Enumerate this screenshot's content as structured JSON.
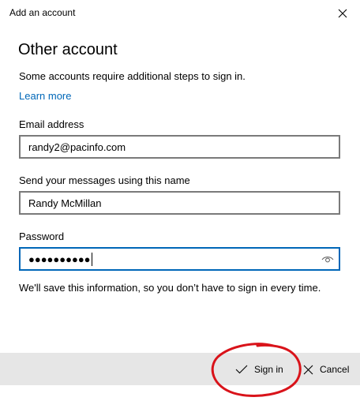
{
  "window": {
    "title": "Add an account"
  },
  "icons": {
    "close": "close-icon",
    "reveal": "eye-icon",
    "sign_in": "checkmark-icon",
    "cancel": "x-icon"
  },
  "main": {
    "heading": "Other account",
    "info": "Some accounts require additional steps to sign in.",
    "learn_more": "Learn more",
    "email_label": "Email address",
    "email_value": "randy2@pacinfo.com",
    "name_label": "Send your messages using this name",
    "name_value": "Randy McMillan",
    "password_label": "Password",
    "password_mask": "●●●●●●●●●●",
    "save_note": "We'll save this information, so you don’t have to sign in every time."
  },
  "footer": {
    "sign_in_label": "Sign in",
    "cancel_label": "Cancel"
  },
  "colors": {
    "accent": "#0067b8",
    "footer_bg": "#e6e6e6",
    "annotation": "#d9131a"
  }
}
